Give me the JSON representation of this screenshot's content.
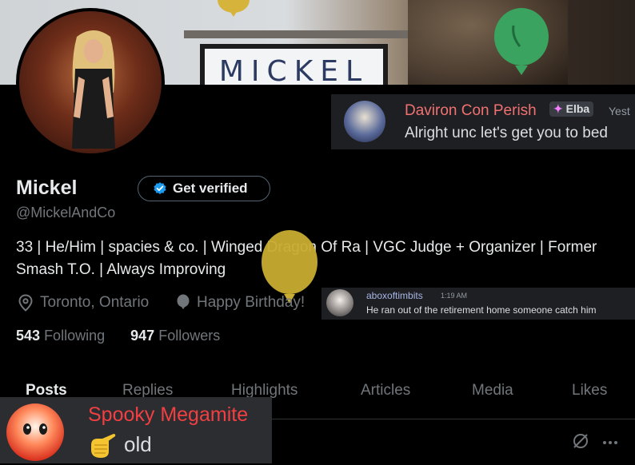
{
  "banner": {
    "sign_text": "MICKEL"
  },
  "profile": {
    "display_name": "Mickel",
    "verify_label": "Get verified",
    "handle": "@MickelAndCo",
    "bio": "33 | He/Him | spacies & co. | Winged Dragon Of Ra | VGC Judge + Organizer | Former Smash T.O. | Always Improving",
    "location": "Toronto, Ontario",
    "birthday": "Happy Birthday!",
    "following_count": "543",
    "following_label": "Following",
    "followers_count": "947",
    "followers_label": "Followers"
  },
  "tabs": [
    {
      "label": "Posts"
    },
    {
      "label": "Replies"
    },
    {
      "label": "Highlights"
    },
    {
      "label": "Articles"
    },
    {
      "label": "Media"
    },
    {
      "label": "Likes"
    }
  ],
  "overlays": {
    "message1": {
      "name": "Daviron Con Perish",
      "tag": "Elba",
      "time": "Yest",
      "text": "Alright unc let's get you to bed"
    },
    "message2": {
      "name": "aboxoftimbits",
      "time": "1:19 AM",
      "text": "He ran out of the retirement home someone catch him"
    },
    "message3": {
      "name": "Spooky Megamite",
      "text": "old"
    }
  },
  "colors": {
    "accent": "#1d9bf0",
    "balloon_yellow": "#d6b43c",
    "balloon_green": "#3aa35f",
    "discord_name_red": "#f07171"
  }
}
